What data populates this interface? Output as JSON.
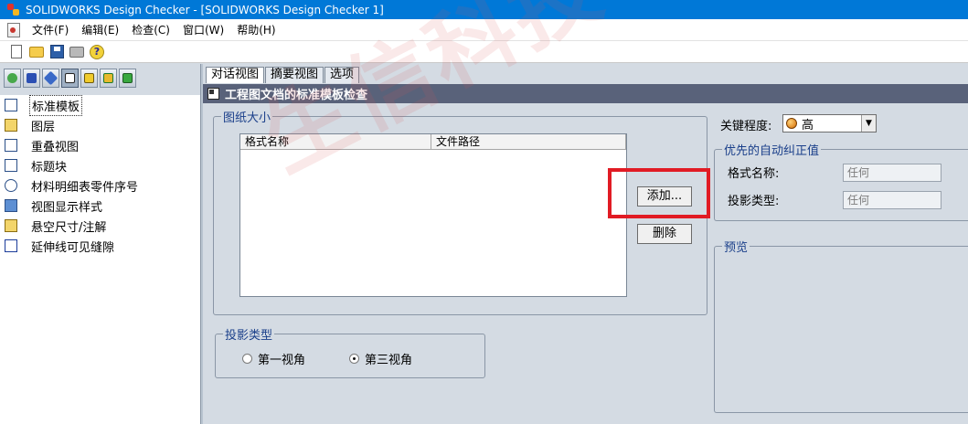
{
  "window": {
    "title": "SOLIDWORKS Design Checker - [SOLIDWORKS Design Checker 1]",
    "icon": "solidworks-logo-icon"
  },
  "menu": [
    "文件(F)",
    "编辑(E)",
    "检查(C)",
    "窗口(W)",
    "帮助(H)"
  ],
  "toolbar": [
    "new-document-icon",
    "open-folder-icon",
    "save-disk-icon",
    "print-icon",
    "help-icon"
  ],
  "left_panel": {
    "strip_icons": [
      "checklist-icon",
      "text-style-icon",
      "dimension-icon",
      "table-icon",
      "part-check-icon",
      "assembly-check-icon",
      "drawing-check-icon"
    ],
    "items": [
      {
        "label": "标准模板",
        "icon": "template-page-icon",
        "selected": true
      },
      {
        "label": "图层",
        "icon": "layers-icon",
        "selected": false
      },
      {
        "label": "重叠视图",
        "icon": "overlapping-views-icon",
        "selected": false
      },
      {
        "label": "标题块",
        "icon": "title-block-icon",
        "selected": false
      },
      {
        "label": "材料明细表零件序号",
        "icon": "balloon-search-icon",
        "selected": false
      },
      {
        "label": "视图显示样式",
        "icon": "view-display-cube-icon",
        "selected": false
      },
      {
        "label": "悬空尺寸/注解",
        "icon": "dangling-dimension-icon",
        "selected": false
      },
      {
        "label": "延伸线可见缝隙",
        "icon": "extension-line-gap-icon",
        "selected": false
      }
    ]
  },
  "tabs": [
    {
      "label": "对话视图",
      "active": true
    },
    {
      "label": "摘要视图",
      "active": false
    },
    {
      "label": "选项",
      "active": false
    }
  ],
  "header": {
    "title": "工程图文档的标准模板检查"
  },
  "sheet_size": {
    "legend": "图纸大小",
    "columns": [
      "格式名称",
      "文件路径"
    ],
    "rows": [],
    "add_button": "添加...",
    "delete_button": "删除"
  },
  "projection": {
    "legend": "投影类型",
    "options": [
      {
        "label": "第一视角",
        "checked": false
      },
      {
        "label": "第三视角",
        "checked": true
      }
    ]
  },
  "severity": {
    "label": "关键程度:",
    "value": "高",
    "icon": "severity-orange-dot-icon"
  },
  "auto_correct": {
    "legend": "优先的自动纠正值",
    "format_label": "格式名称:",
    "format_value": "任何",
    "projection_label": "投影类型:",
    "projection_value": "任何"
  },
  "preview": {
    "legend": "预览"
  },
  "watermark": "生信科技",
  "highlight_color": "#e11b24"
}
